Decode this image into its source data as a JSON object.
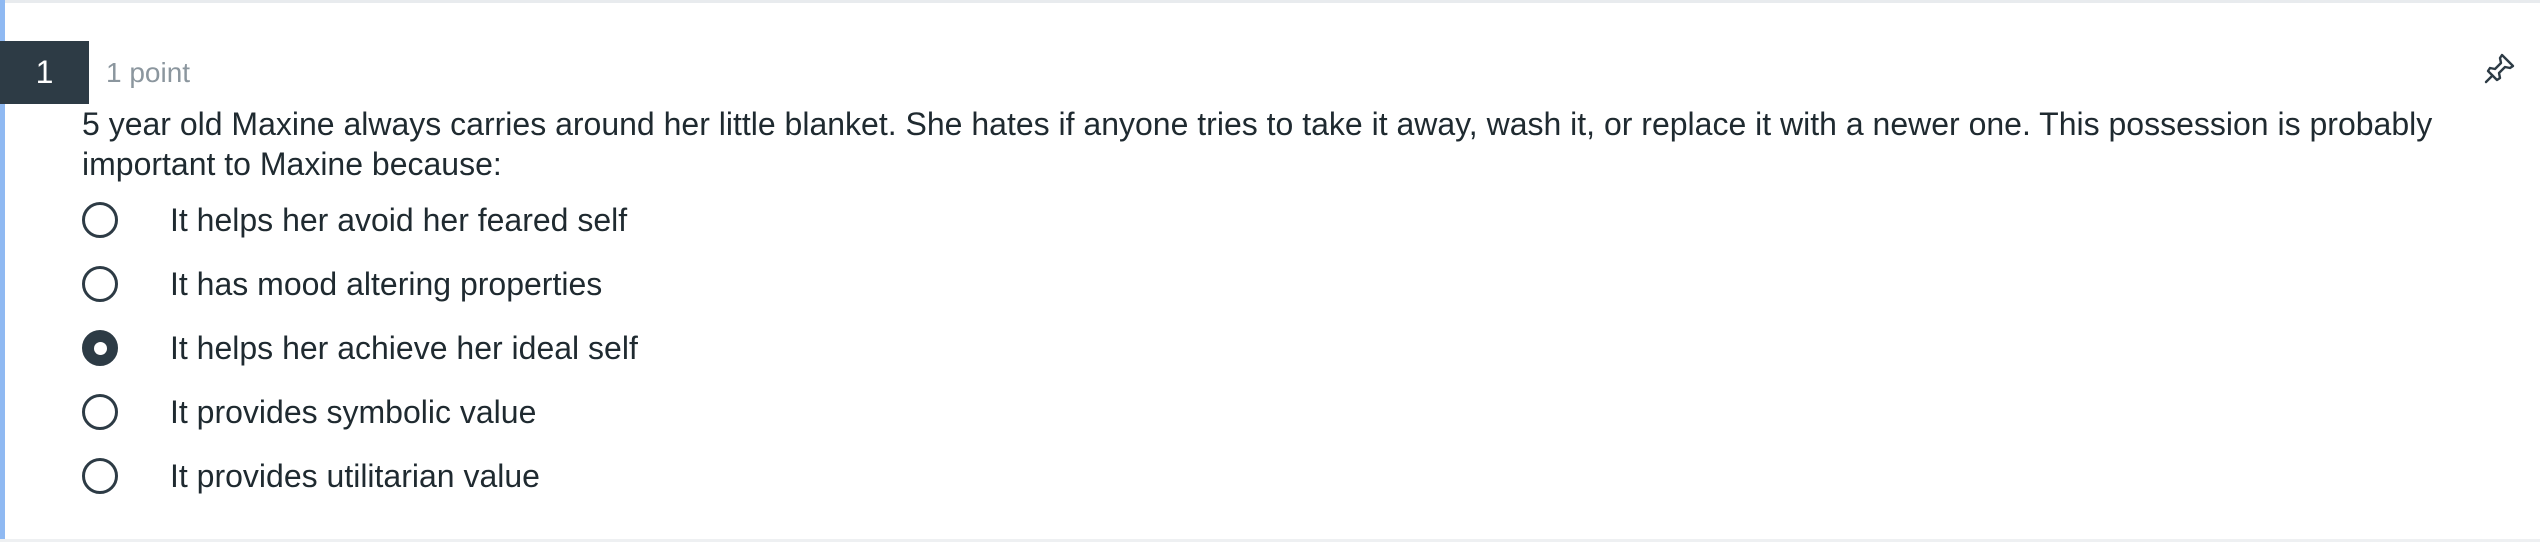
{
  "question": {
    "number": "1",
    "points": "1 point",
    "text": "5 year old Maxine always carries around her little blanket. She hates if anyone tries to take it away, wash it, or replace it with a newer one. This possession is probably important to Maxine because:",
    "pin_icon": "pin-icon",
    "answers": [
      {
        "label": "It helps her avoid her feared self",
        "selected": false
      },
      {
        "label": "It has mood altering properties",
        "selected": false
      },
      {
        "label": "It helps her achieve her ideal self",
        "selected": true
      },
      {
        "label": "It provides symbolic value",
        "selected": false
      },
      {
        "label": "It provides utilitarian value",
        "selected": false
      }
    ]
  },
  "colors": {
    "number_badge_bg": "#2d3b45",
    "left_accent": "#8fb9f2",
    "points_text": "#8b969e"
  }
}
